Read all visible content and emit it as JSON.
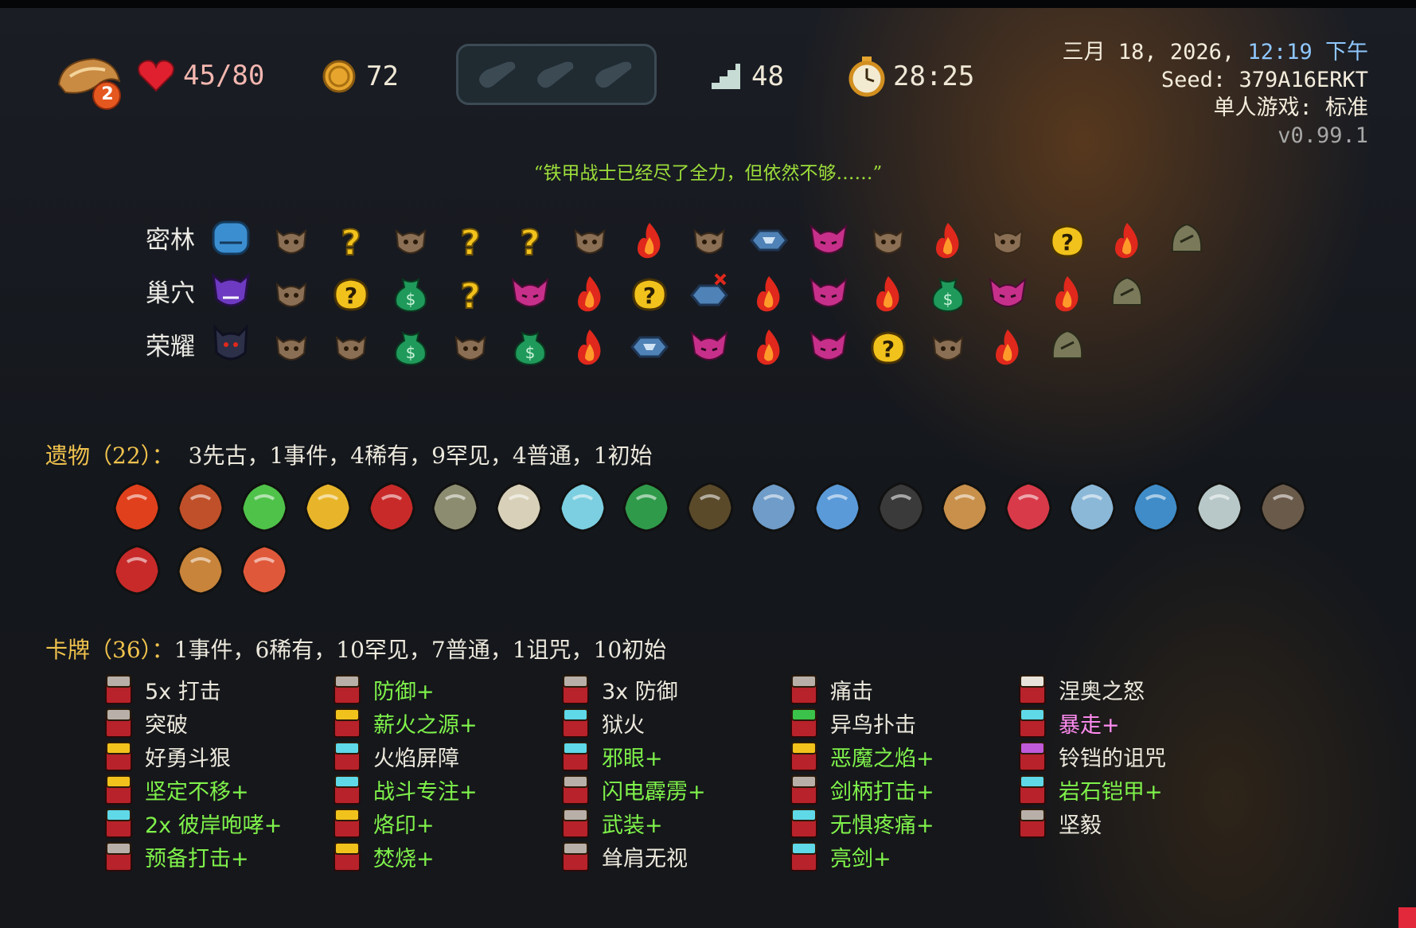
{
  "hud": {
    "hp": "45/80",
    "gold": "72",
    "floor": "48",
    "time": "28:25",
    "ascension": "2",
    "potion_slots": [
      "empty-potion-slot",
      "empty-potion-slot",
      "empty-potion-slot"
    ]
  },
  "info": {
    "date_prefix": "三月 18, 2026, ",
    "time": "12:19 下午",
    "seed": "Seed: 379A16ERKT",
    "mode": "单人游戏: 标准",
    "version": "v0.99.1"
  },
  "quote": "“铁甲战士已经尽了全力，但依然不够……”",
  "map": {
    "acts": [
      {
        "name": "密林",
        "boss_icon": "slime-boss-icon",
        "nodes": [
          "monster",
          "unknown",
          "monster",
          "unknown",
          "unknown",
          "monster",
          "rest",
          "monster",
          "treasure",
          "elite",
          "monster",
          "rest",
          "monster",
          "unknown-event",
          "rest",
          "boss"
        ]
      },
      {
        "name": "巢穴",
        "boss_icon": "champ-boss-icon",
        "nodes": [
          "monster",
          "unknown-event",
          "merchant",
          "unknown",
          "elite",
          "rest",
          "unknown-event",
          "treasure-skipped",
          "rest",
          "elite",
          "rest",
          "merchant",
          "elite",
          "rest",
          "boss"
        ]
      },
      {
        "name": "荣耀",
        "boss_icon": "awakened-boss-icon",
        "nodes": [
          "monster",
          "monster",
          "merchant",
          "monster",
          "merchant",
          "rest",
          "treasure",
          "elite",
          "rest",
          "elite",
          "unknown-event",
          "monster",
          "rest",
          "boss"
        ]
      }
    ]
  },
  "relics": {
    "title": "遗物（22）：",
    "summary": "3先古，1事件，4稀有，9罕见，4普通，1初始",
    "items": [
      "burning-blood-icon",
      "treasure-chest-relic-icon",
      "parrot-relic-icon",
      "sunflower-relic-icon",
      "red-skull-icon",
      "candelabra-icon",
      "bell-icon",
      "ticket-icon",
      "lizard-tail-icon",
      "lava-egg-icon",
      "bone-club-icon",
      "feather-icon",
      "ring-icon",
      "pot-icon",
      "red-mask-icon",
      "twisted-funnel-icon",
      "anvil-icon",
      "triangle-icon",
      "cannon-icon",
      "nunchaku-icon",
      "crate-icon",
      "flower-mask-icon"
    ]
  },
  "cards": {
    "title": "卡牌（36）：",
    "summary": "1事件，6稀有，10罕见，7普通，1诅咒，10初始",
    "columns": [
      [
        {
          "name": "5x 打击",
          "color": "white",
          "icon": "gray"
        },
        {
          "name": "突破",
          "color": "white",
          "icon": "gray"
        },
        {
          "name": "好勇斗狠",
          "color": "white",
          "icon": "gold"
        },
        {
          "name": "坚定不移+",
          "color": "green",
          "icon": "gold"
        },
        {
          "name": "2x 彼岸咆哮+",
          "color": "green",
          "icon": "cyan"
        },
        {
          "name": "预备打击+",
          "color": "green",
          "icon": "gray"
        }
      ],
      [
        {
          "name": "防御+",
          "color": "green",
          "icon": "gray"
        },
        {
          "name": "薪火之源+",
          "color": "green",
          "icon": "gold"
        },
        {
          "name": "火焰屏障",
          "color": "white",
          "icon": "cyan"
        },
        {
          "name": "战斗专注+",
          "color": "green",
          "icon": "cyan"
        },
        {
          "name": "烙印+",
          "color": "green",
          "icon": "gold"
        },
        {
          "name": "焚烧+",
          "color": "green",
          "icon": "gold"
        }
      ],
      [
        {
          "name": "3x 防御",
          "color": "white",
          "icon": "gray"
        },
        {
          "name": "狱火",
          "color": "white",
          "icon": "cyan"
        },
        {
          "name": "邪眼+",
          "color": "green",
          "icon": "cyan"
        },
        {
          "name": "闪电霹雳+",
          "color": "green",
          "icon": "gray"
        },
        {
          "name": "武装+",
          "color": "green",
          "icon": "gray"
        },
        {
          "name": "耸肩无视",
          "color": "white",
          "icon": "gray"
        }
      ],
      [
        {
          "name": "痛击",
          "color": "white",
          "icon": "gray"
        },
        {
          "name": "异鸟扑击",
          "color": "white",
          "icon": "green"
        },
        {
          "name": "恶魔之焰+",
          "color": "green",
          "icon": "gold"
        },
        {
          "name": "剑柄打击+",
          "color": "green",
          "icon": "gray"
        },
        {
          "name": "无惧疼痛+",
          "color": "green",
          "icon": "cyan"
        },
        {
          "name": "亮剑+",
          "color": "green",
          "icon": "cyan"
        }
      ],
      [
        {
          "name": "涅奥之怒",
          "color": "white",
          "icon": "white"
        },
        {
          "name": "暴走+",
          "color": "pink",
          "icon": "cyan"
        },
        {
          "name": "铃铛的诅咒",
          "color": "white",
          "icon": "purple"
        },
        {
          "name": "岩石铠甲+",
          "color": "green",
          "icon": "cyan"
        },
        {
          "name": "坚毅",
          "color": "white",
          "icon": "gray"
        }
      ]
    ]
  }
}
